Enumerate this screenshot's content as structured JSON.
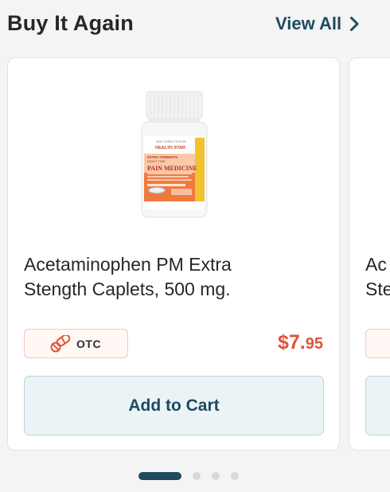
{
  "section": {
    "title": "Buy It Again",
    "view_all_label": "View All"
  },
  "cards": [
    {
      "product_name_line1": "Acetaminophen PM Extra",
      "product_name_line2": "Stength Caplets, 500 mg.",
      "badge_label": "OTC",
      "price_dollars": "$7.",
      "price_cents": "95",
      "add_to_cart_label": "Add to Cart",
      "image": {
        "brand": "HEALTH STAR",
        "tag_line1": "EXTRA STRENGTH",
        "tag_line2": "NIGHT TIME",
        "product": "PAIN MEDICINE",
        "count": "500 Caplets"
      }
    },
    {
      "product_name_line1": "Ac",
      "product_name_line2": "Ste"
    }
  ],
  "pagination": {
    "total": 4,
    "active_index": 0
  },
  "colors": {
    "accent": "#1f4a5e",
    "price": "#de5538",
    "badge_border": "#f2c9bd"
  }
}
